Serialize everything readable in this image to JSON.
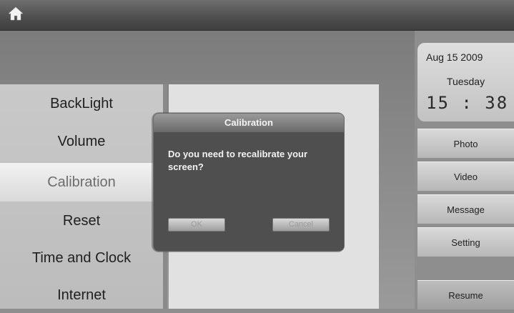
{
  "topbar": {
    "home_icon": "home-icon"
  },
  "menu": {
    "items": [
      {
        "label": "BackLight",
        "selected": false
      },
      {
        "label": "Volume",
        "selected": false
      },
      {
        "label": "Calibration",
        "selected": true
      },
      {
        "label": "Reset",
        "selected": false
      },
      {
        "label": "Time and Clock",
        "selected": false
      },
      {
        "label": "Internet",
        "selected": false
      }
    ]
  },
  "dialog": {
    "title": "Calibration",
    "message": "Do you need to recalibrate your screen?",
    "ok_label": "OK",
    "cancel_label": "Cancel"
  },
  "clock": {
    "date": "Aug 15  2009",
    "day": "Tuesday",
    "time": "15 : 38"
  },
  "side_buttons": {
    "photo": "Photo",
    "video": "Video",
    "message": "Message",
    "setting": "Setting",
    "resume": "Resume"
  },
  "colors": {
    "topbar": "#4d4d4d",
    "menu_bg": "#c4c4c4",
    "dialog_bg": "#4f4f4f",
    "selected_item": "#e6e6e6"
  }
}
